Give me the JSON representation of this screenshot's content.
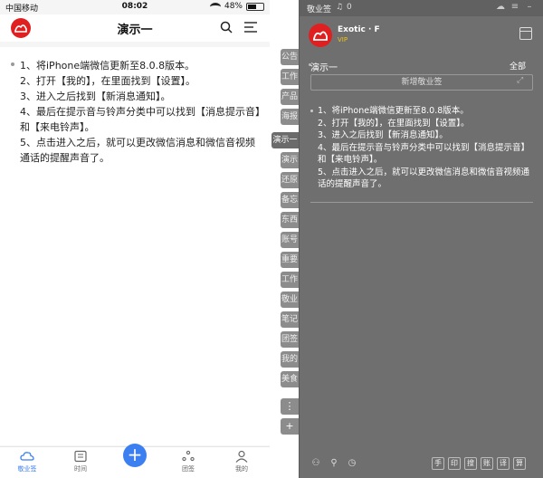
{
  "phone": {
    "status": {
      "carrier": "中国移动",
      "time": "08:02",
      "battery": "48%"
    },
    "nav": {
      "title": "演示一"
    },
    "note": {
      "lines": [
        "1、将iPhone端微信更新至8.0.8版本。",
        "2、打开【我的】，在里面找到【设置】。",
        "3、进入之后找到【新消息通知】。",
        "4、最后在提示音与铃声分类中可以找到【消息提示音】和【来电铃声】。",
        "5、点击进入之后，就可以更改微信消息和微信音视频通话的提醒声音了。"
      ]
    },
    "tabs": [
      {
        "label": "敬业签",
        "icon": "cloud-icon",
        "active": true
      },
      {
        "label": "时间",
        "icon": "calendar-icon",
        "active": false
      },
      {
        "label": "团签",
        "icon": "team-icon",
        "active": false
      },
      {
        "label": "我的",
        "icon": "user-icon",
        "active": false
      }
    ],
    "fab_label": "+"
  },
  "vtabs": [
    "公告",
    "工作",
    "产品",
    "海报",
    "演示一",
    "演示",
    "还原",
    "备忘",
    "东西",
    "账号",
    "重要",
    "工作",
    "敬业",
    "笔记",
    "团签",
    "我的",
    "美食"
  ],
  "vtab_more": "⋮",
  "vtab_add": "+",
  "widget": {
    "app_name": "敬业签",
    "bell_count": "0",
    "user": "Exotic · F",
    "vip": "VIP",
    "category": "演示一",
    "filter": "全部",
    "new_note": "新增敬业签",
    "note_lines": [
      "1、将iPhone端微信更新至8.0.8版本。",
      "2、打开【我的】，在里面找到【设置】。",
      "3、进入之后找到【新消息通知】。",
      "4、最后在提示音与铃声分类中可以找到【消息提示音】和【来电铃声】。",
      "5、点击进入之后，就可以更改微信消息和微信音视频通话的提醒声音了。"
    ],
    "tools": [
      "手",
      "印",
      "搜",
      "账",
      "译",
      "算"
    ]
  },
  "colors": {
    "accent": "#3b7ff0",
    "brand": "#e02020",
    "widget_bg": "#6f6f6f"
  }
}
